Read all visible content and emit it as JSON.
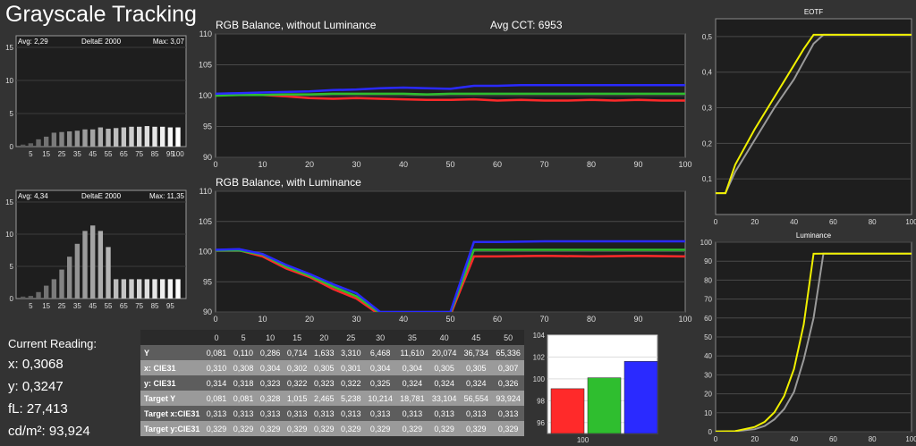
{
  "title": "Grayscale Tracking",
  "current_reading": {
    "label": "Current Reading:",
    "x": "x: 0,3068",
    "y": "y: 0,3247",
    "fl": "fL: 27,413",
    "cdm2": "cd/m²: 93,924"
  },
  "colors": {
    "red": "#ff2a2a",
    "green": "#2fbe2f",
    "blue": "#2a2aff",
    "yellow": "#f0f000",
    "gray": "#9a9a9a"
  },
  "chart_data": [
    {
      "id": "deltae_top",
      "type": "bar",
      "title": "DeltaE 2000",
      "avg_label": "Avg: 2,29",
      "max_label": "Max: 3,07",
      "ylim": [
        0,
        15
      ],
      "yticks": [
        0,
        5,
        10,
        15
      ],
      "categories": [
        0,
        5,
        10,
        15,
        20,
        25,
        30,
        35,
        40,
        45,
        50,
        55,
        60,
        65,
        70,
        75,
        80,
        85,
        90,
        95,
        100
      ],
      "xticks": [
        5,
        15,
        25,
        35,
        45,
        55,
        65,
        75,
        85,
        95,
        100
      ],
      "values": [
        0.3,
        0.5,
        1.1,
        1.5,
        2.1,
        2.2,
        2.3,
        2.4,
        2.6,
        2.6,
        2.9,
        2.7,
        2.8,
        2.9,
        3.0,
        3.0,
        3.1,
        3.0,
        3.0,
        2.9,
        2.9
      ]
    },
    {
      "id": "deltae_bottom",
      "type": "bar",
      "title": "DeltaE 2000",
      "avg_label": "Avg: 4,34",
      "max_label": "Max: 11,35",
      "ylim": [
        0,
        15
      ],
      "yticks": [
        0,
        5,
        10,
        15
      ],
      "categories": [
        0,
        5,
        10,
        15,
        20,
        25,
        30,
        35,
        40,
        45,
        50,
        55,
        60,
        65,
        70,
        75,
        80,
        85,
        90,
        95,
        100
      ],
      "xticks": [
        5,
        15,
        25,
        35,
        45,
        55,
        65,
        75,
        85,
        95
      ],
      "values": [
        0.3,
        0.4,
        1.0,
        2.0,
        3.0,
        4.5,
        6.5,
        8.5,
        10.5,
        11.35,
        10.5,
        8.0,
        3.0,
        3.0,
        3.0,
        3.0,
        3.0,
        3.0,
        3.0,
        3.0,
        3.0
      ]
    },
    {
      "id": "rgb_without",
      "type": "line",
      "title": "RGB Balance, without Luminance",
      "subtitle": "Avg CCT: 6953",
      "xlim": [
        0,
        100
      ],
      "ylim": [
        90,
        110
      ],
      "xticks": [
        0,
        10,
        20,
        30,
        40,
        50,
        60,
        70,
        80,
        90,
        100
      ],
      "yticks": [
        90,
        95,
        100,
        105,
        110
      ],
      "x": [
        0,
        5,
        10,
        15,
        20,
        25,
        30,
        35,
        40,
        45,
        50,
        55,
        60,
        65,
        70,
        75,
        80,
        85,
        90,
        95,
        100
      ],
      "series": [
        {
          "color": "red",
          "values": [
            100.2,
            100.2,
            100.1,
            99.9,
            99.6,
            99.5,
            99.6,
            99.5,
            99.4,
            99.3,
            99.3,
            99.4,
            99.2,
            99.3,
            99.2,
            99.2,
            99.3,
            99.2,
            99.3,
            99.2,
            99.2
          ]
        },
        {
          "color": "green",
          "values": [
            100.0,
            100.1,
            100.1,
            100.2,
            100.2,
            100.3,
            100.3,
            100.3,
            100.3,
            100.2,
            100.3,
            100.3,
            100.3,
            100.3,
            100.3,
            100.3,
            100.3,
            100.3,
            100.3,
            100.3,
            100.3
          ]
        },
        {
          "color": "blue",
          "values": [
            100.3,
            100.4,
            100.5,
            100.6,
            100.7,
            100.9,
            101.0,
            101.2,
            101.3,
            101.2,
            101.1,
            101.6,
            101.6,
            101.7,
            101.7,
            101.7,
            101.7,
            101.7,
            101.7,
            101.7,
            101.7
          ]
        }
      ]
    },
    {
      "id": "rgb_with",
      "type": "line",
      "title": "RGB Balance, with Luminance",
      "xlim": [
        0,
        100
      ],
      "ylim": [
        90,
        110
      ],
      "xticks": [
        0,
        10,
        20,
        30,
        40,
        50,
        60,
        70,
        80,
        90,
        100
      ],
      "yticks": [
        90,
        95,
        100,
        105,
        110
      ],
      "series": [
        {
          "color": "red",
          "points": [
            [
              0,
              100.2
            ],
            [
              5,
              100.2
            ],
            [
              10,
              99.2
            ],
            [
              15,
              97.2
            ],
            [
              20,
              95.8
            ],
            [
              25,
              93.8
            ],
            [
              30,
              92.2
            ],
            [
              35,
              89.5
            ],
            [
              50,
              89.5
            ],
            [
              55,
              99.2
            ],
            [
              60,
              99.2
            ],
            [
              70,
              99.3
            ],
            [
              80,
              99.2
            ],
            [
              90,
              99.3
            ],
            [
              100,
              99.2
            ]
          ]
        },
        {
          "color": "green",
          "points": [
            [
              0,
              100.2
            ],
            [
              5,
              100.2
            ],
            [
              10,
              99.5
            ],
            [
              15,
              97.5
            ],
            [
              20,
              96.0
            ],
            [
              25,
              94.2
            ],
            [
              30,
              92.6
            ],
            [
              35,
              89.8
            ],
            [
              50,
              89.8
            ],
            [
              55,
              100.3
            ],
            [
              60,
              100.3
            ],
            [
              70,
              100.3
            ],
            [
              80,
              100.3
            ],
            [
              90,
              100.3
            ],
            [
              100,
              100.3
            ]
          ]
        },
        {
          "color": "blue",
          "points": [
            [
              0,
              100.3
            ],
            [
              5,
              100.4
            ],
            [
              10,
              99.6
            ],
            [
              15,
              97.8
            ],
            [
              20,
              96.3
            ],
            [
              25,
              94.6
            ],
            [
              30,
              93.1
            ],
            [
              35,
              90.0
            ],
            [
              50,
              90.0
            ],
            [
              55,
              101.6
            ],
            [
              60,
              101.6
            ],
            [
              70,
              101.7
            ],
            [
              80,
              101.7
            ],
            [
              90,
              101.7
            ],
            [
              100,
              101.7
            ]
          ]
        }
      ]
    },
    {
      "id": "eotf",
      "type": "line",
      "title": "EOTF",
      "xlim": [
        0,
        100
      ],
      "ylim": [
        0,
        0.55
      ],
      "xticks": [
        0,
        20,
        40,
        60,
        80,
        100
      ],
      "xtick_labels": [
        "0",
        "20",
        "40",
        "60",
        "80",
        "100"
      ],
      "yticks": [
        0.1,
        0.2,
        0.3,
        0.4,
        0.5
      ],
      "ytick_labels": [
        "0,1",
        "0,2",
        "0,3",
        "0,4",
        "0,5"
      ],
      "series": [
        {
          "color": "gray",
          "points": [
            [
              0,
              0.06
            ],
            [
              5,
              0.06
            ],
            [
              10,
              0.12
            ],
            [
              20,
              0.21
            ],
            [
              30,
              0.3
            ],
            [
              40,
              0.38
            ],
            [
              45,
              0.43
            ],
            [
              50,
              0.48
            ],
            [
              55,
              0.505
            ],
            [
              60,
              0.505
            ],
            [
              100,
              0.505
            ]
          ]
        },
        {
          "color": "yellow",
          "points": [
            [
              0,
              0.06
            ],
            [
              5,
              0.06
            ],
            [
              10,
              0.14
            ],
            [
              20,
              0.24
            ],
            [
              30,
              0.33
            ],
            [
              40,
              0.42
            ],
            [
              45,
              0.465
            ],
            [
              50,
              0.505
            ],
            [
              55,
              0.505
            ],
            [
              100,
              0.505
            ]
          ]
        }
      ]
    },
    {
      "id": "luminance",
      "type": "line",
      "title": "Luminance",
      "xlim": [
        0,
        100
      ],
      "ylim": [
        0,
        100
      ],
      "xticks": [
        0,
        20,
        40,
        60,
        80,
        100
      ],
      "xtick_labels": [
        "0",
        "20",
        "40",
        "60",
        "80",
        "100"
      ],
      "yticks": [
        0,
        10,
        20,
        30,
        40,
        50,
        60,
        70,
        80,
        90,
        100
      ],
      "series": [
        {
          "color": "gray",
          "points": [
            [
              0,
              0.1
            ],
            [
              10,
              0.3
            ],
            [
              20,
              1.3
            ],
            [
              25,
              3
            ],
            [
              30,
              6.5
            ],
            [
              35,
              12
            ],
            [
              40,
              21
            ],
            [
              45,
              38
            ],
            [
              50,
              60
            ],
            [
              55,
              94
            ],
            [
              60,
              94
            ],
            [
              100,
              94
            ]
          ]
        },
        {
          "color": "yellow",
          "points": [
            [
              0,
              0.1
            ],
            [
              10,
              0.3
            ],
            [
              20,
              2.5
            ],
            [
              25,
              5.2
            ],
            [
              30,
              10.2
            ],
            [
              35,
              18.8
            ],
            [
              40,
              33.1
            ],
            [
              45,
              56.6
            ],
            [
              50,
              93.9
            ],
            [
              55,
              94
            ],
            [
              100,
              94
            ]
          ]
        }
      ]
    },
    {
      "id": "rgb_bars",
      "type": "bar",
      "categories": [
        "100"
      ],
      "ylim": [
        95,
        104
      ],
      "yticks": [
        96,
        98,
        100,
        102,
        104
      ],
      "series": [
        {
          "color": "red",
          "values": [
            99.1
          ]
        },
        {
          "color": "green",
          "values": [
            100.1
          ]
        },
        {
          "color": "blue",
          "values": [
            101.6
          ]
        }
      ]
    }
  ],
  "table": {
    "header": [
      "",
      "0",
      "5",
      "10",
      "15",
      "20",
      "25",
      "30",
      "35",
      "40",
      "45",
      "50"
    ],
    "rows": [
      {
        "label": "Y",
        "values": [
          "0,081",
          "0,110",
          "0,286",
          "0,714",
          "1,633",
          "3,310",
          "6,468",
          "11,610",
          "20,074",
          "36,734",
          "65,336"
        ]
      },
      {
        "label": "x: CIE31",
        "values": [
          "0,310",
          "0,308",
          "0,304",
          "0,302",
          "0,305",
          "0,301",
          "0,304",
          "0,304",
          "0,305",
          "0,305",
          "0,307"
        ]
      },
      {
        "label": "y: CIE31",
        "values": [
          "0,314",
          "0,318",
          "0,323",
          "0,322",
          "0,323",
          "0,322",
          "0,325",
          "0,324",
          "0,324",
          "0,324",
          "0,326"
        ]
      },
      {
        "label": "Target Y",
        "values": [
          "0,081",
          "0,081",
          "0,328",
          "1,015",
          "2,465",
          "5,238",
          "10,214",
          "18,781",
          "33,104",
          "56,554",
          "93,924"
        ]
      },
      {
        "label": "Target x:CIE31",
        "values": [
          "0,313",
          "0,313",
          "0,313",
          "0,313",
          "0,313",
          "0,313",
          "0,313",
          "0,313",
          "0,313",
          "0,313",
          "0,313"
        ]
      },
      {
        "label": "Target y:CIE31",
        "values": [
          "0,329",
          "0,329",
          "0,329",
          "0,329",
          "0,329",
          "0,329",
          "0,329",
          "0,329",
          "0,329",
          "0,329",
          "0,329"
        ]
      }
    ]
  }
}
